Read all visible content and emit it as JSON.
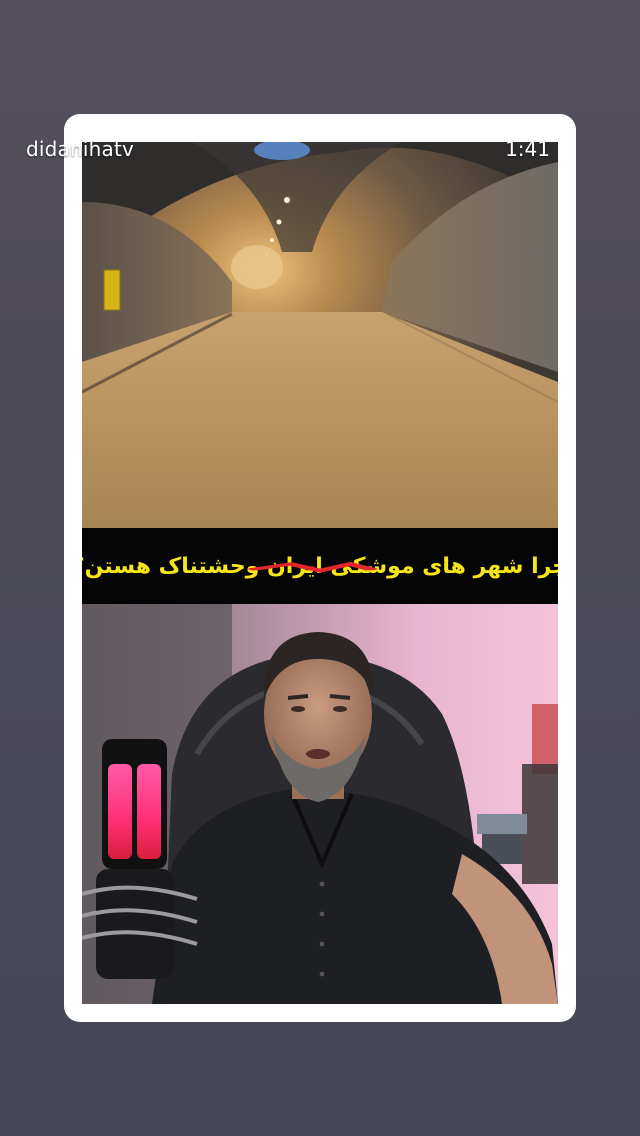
{
  "header": {
    "username": "didanihatv",
    "duration": "1:41"
  },
  "caption": {
    "text": "چرا شهر های موشکی ایران وحشتناک هستن؟",
    "text_color": "#f7e617",
    "band_color": "#050505",
    "strike_color": "#e3262b"
  },
  "colors": {
    "page_background": "#4c4a57",
    "card_background": "#ffffff",
    "mic_glow": "#ff4fa3"
  },
  "media": {
    "top_scene": "tunnel",
    "bottom_scene": "person-with-microphone"
  }
}
